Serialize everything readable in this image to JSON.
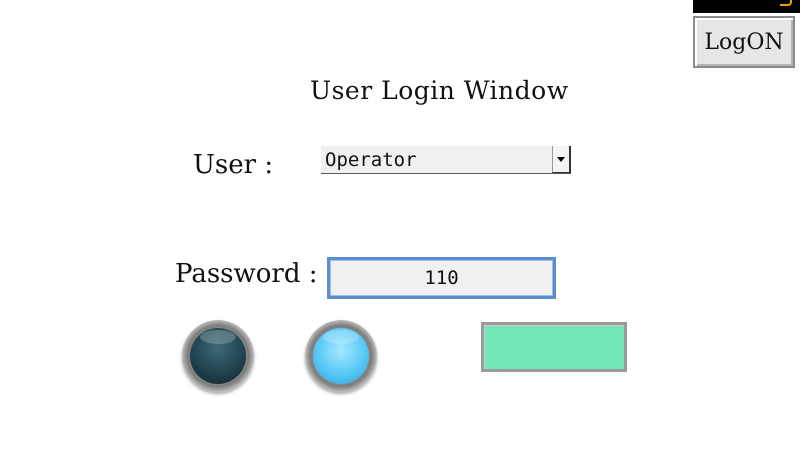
{
  "window": {
    "title": "User Login Window"
  },
  "header": {
    "logon_button_label": "LogON",
    "topbar_accent_color": "#e7a400"
  },
  "form": {
    "user_label": "User :",
    "user_select": {
      "selected": "Operator"
    },
    "password_label": "Password :",
    "password_value": "110"
  },
  "indicators": {
    "lamp_off_color": "#214450",
    "lamp_on_color": "#58c8f6",
    "action_button_color": "#72e6b6"
  }
}
